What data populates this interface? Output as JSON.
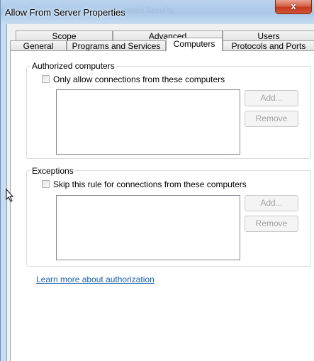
{
  "window": {
    "title": "Allow From Server Properties",
    "ghost_title": "anced Security",
    "close_glyph": "x"
  },
  "tabs_row1": [
    {
      "label": "Scope"
    },
    {
      "label": "Advanced"
    },
    {
      "label": "Users"
    }
  ],
  "tabs_row2": [
    {
      "label": "General"
    },
    {
      "label": "Programs and Services"
    },
    {
      "label": "Computers",
      "active": true
    },
    {
      "label": "Protocols and Ports"
    }
  ],
  "authorized": {
    "group_label": "Authorized computers",
    "checkbox_label": "Only allow connections from these computers",
    "checked": false,
    "add_label": "Add...",
    "remove_label": "Remove"
  },
  "exceptions": {
    "group_label": "Exceptions",
    "checkbox_label": "Skip this rule for connections from these computers",
    "checked": false,
    "add_label": "Add...",
    "remove_label": "Remove"
  },
  "help_link": "Learn more about authorization",
  "icons": {
    "cursor": "resize-cursor-icon",
    "close": "close-icon"
  }
}
